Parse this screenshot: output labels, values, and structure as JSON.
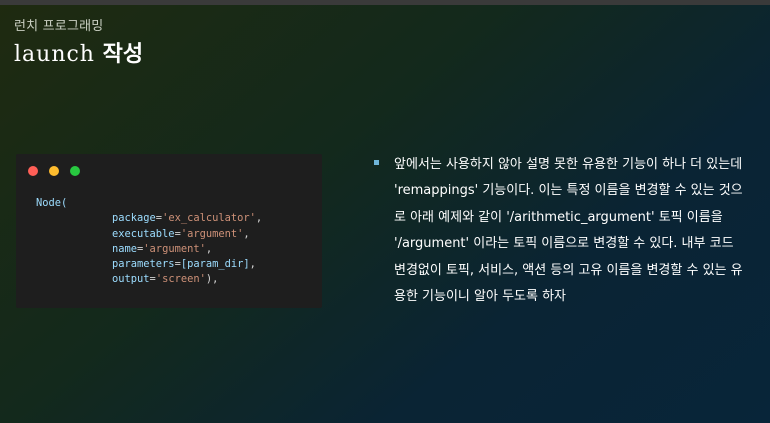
{
  "slide": {
    "subtitle": "런치 프로그래밍",
    "title_latin": "launch",
    "title_korean": "작성"
  },
  "code_window": {
    "dot_colors": [
      "#ff5f57",
      "#febc2e",
      "#28c840"
    ],
    "call": "Node(",
    "args": [
      {
        "key": "package",
        "value": "'ex_calculator'"
      },
      {
        "key": "executable",
        "value": "'argument'"
      },
      {
        "key": "name",
        "value": "'argument'"
      },
      {
        "key": "parameters",
        "value": "[param_dir]"
      },
      {
        "key": "output",
        "value": "'screen'"
      }
    ],
    "closing": "),"
  },
  "bullet": {
    "marker_color": "#6fb6d9",
    "text": "앞에서는 사용하지 않아 설명 못한 유용한 기능이 하나 더 있는데 'remappings' 기능이다. 이는 특정 이름을 변경할 수 있는 것으로 아래 예제와 같이 '/arithmetic_argument' 토픽 이름을 '/argument' 이라는 토픽 이름으로 변경할 수 있다. 내부 코드 변경없이 토픽, 서비스, 액션 등의 고유 이름을 변경할 수 있는 유용한 기능이니 알아 두도록 하자"
  }
}
